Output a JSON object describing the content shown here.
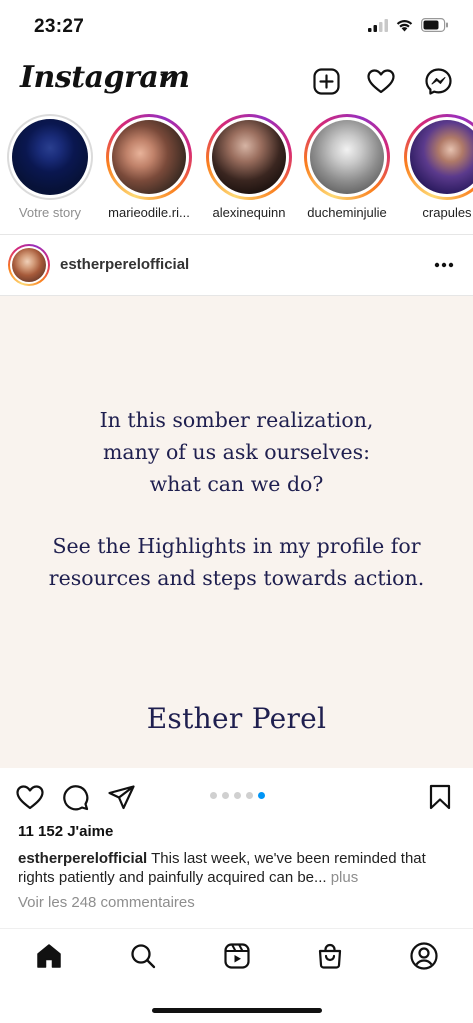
{
  "status_bar": {
    "time": "23:27"
  },
  "header": {
    "logo": "Instagram",
    "icons": [
      "chevron-down-icon",
      "new-post-icon",
      "heart-icon",
      "messenger-icon"
    ]
  },
  "stories": [
    {
      "label": "Votre story",
      "own": true
    },
    {
      "label": "marieodile.ri..."
    },
    {
      "label": "alexinequinn"
    },
    {
      "label": "ducheminjulie"
    },
    {
      "label": "crapules"
    }
  ],
  "post": {
    "username": "estherperelofficial",
    "quote_lines": [
      "In this somber realization,",
      "many of us ask ourselves:",
      "what can we do?"
    ],
    "quote_lines_2": [
      "See the Highlights in my profile for",
      "resources and steps towards action."
    ],
    "signature": "Esther Perel",
    "carousel": {
      "count": 5,
      "active": 5
    },
    "likes": "11 152 J'aime",
    "caption_user": "estherperelofficial",
    "caption_text": "This last week, we've been reminded that rights patiently and painfully acquired can be...",
    "caption_more": "plus",
    "comments_link": "Voir les 248 commentaires"
  },
  "tab_bar": {
    "icons": [
      "home-icon",
      "search-icon",
      "reels-icon",
      "shop-icon",
      "profile-icon"
    ]
  },
  "colors": {
    "accent": "#0095f6",
    "post_bg": "#f9f3ee",
    "quote_text": "#1f1f4f",
    "muted": "#8e8e8e"
  }
}
